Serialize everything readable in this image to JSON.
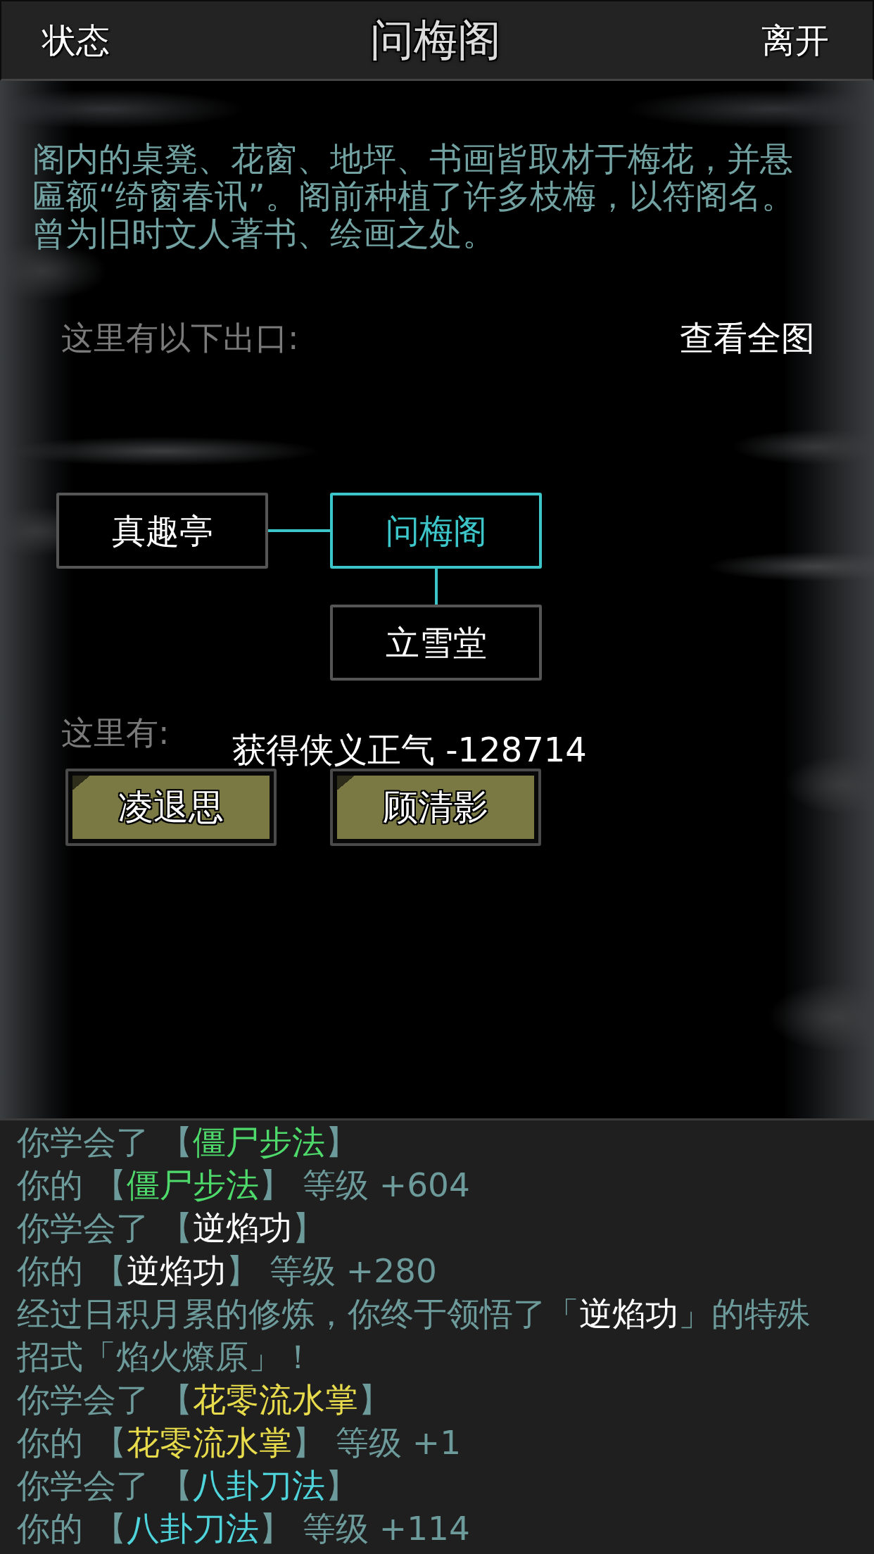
{
  "header": {
    "left_button": "状态",
    "title": "问梅阁",
    "right_button": "离开"
  },
  "description": {
    "lines": [
      "阁内的桌凳、花窗、地坪、书画皆取材于梅花，并悬",
      "匾额“绮窗春讯”。阁前种植了许多枝梅，以符阁名。",
      "曾为旧时文人著书、绘画之处。"
    ]
  },
  "exits": {
    "label": "这里有以下出口:",
    "view_map": "查看全图",
    "map": {
      "west": {
        "name": "真趣亭",
        "current": false
      },
      "center": {
        "name": "问梅阁",
        "current": true
      },
      "south": {
        "name": "立雪堂",
        "current": false
      }
    }
  },
  "present": {
    "label": "这里有:",
    "npcs": [
      "凌退思",
      "顾清影"
    ]
  },
  "notice": "获得侠义正气 -128714",
  "log": [
    {
      "segments": [
        {
          "text": "你学会了 【"
        },
        {
          "text": "僵尸步法",
          "color": "#4fdb6c"
        },
        {
          "text": "】"
        }
      ]
    },
    {
      "segments": [
        {
          "text": "你的 【"
        },
        {
          "text": "僵尸步法",
          "color": "#4fdb6c"
        },
        {
          "text": "】 等级 +604"
        }
      ]
    },
    {
      "segments": [
        {
          "text": "你学会了 【"
        },
        {
          "text": "逆焰功",
          "color": "#ffffff"
        },
        {
          "text": "】"
        }
      ]
    },
    {
      "segments": [
        {
          "text": "你的 【"
        },
        {
          "text": "逆焰功",
          "color": "#ffffff"
        },
        {
          "text": "】 等级 +280"
        }
      ]
    },
    {
      "segments": [
        {
          "text": "经过日积月累的修炼，你终于领悟了「"
        },
        {
          "text": "逆焰功",
          "color": "#ffffff"
        },
        {
          "text": "」的特殊招式「焰火燎原」！"
        }
      ]
    },
    {
      "segments": [
        {
          "text": "你学会了 【"
        },
        {
          "text": "花零流水掌",
          "color": "#e8dc4c"
        },
        {
          "text": "】"
        }
      ]
    },
    {
      "segments": [
        {
          "text": "你的 【"
        },
        {
          "text": "花零流水掌",
          "color": "#e8dc4c"
        },
        {
          "text": "】 等级 +1"
        }
      ]
    },
    {
      "segments": [
        {
          "text": "你学会了 【"
        },
        {
          "text": "八卦刀法",
          "color": "#4fd4dc"
        },
        {
          "text": "】"
        }
      ]
    },
    {
      "segments": [
        {
          "text": "你的 【"
        },
        {
          "text": "八卦刀法",
          "color": "#4fd4dc"
        },
        {
          "text": "】 等级 +114"
        }
      ]
    }
  ]
}
